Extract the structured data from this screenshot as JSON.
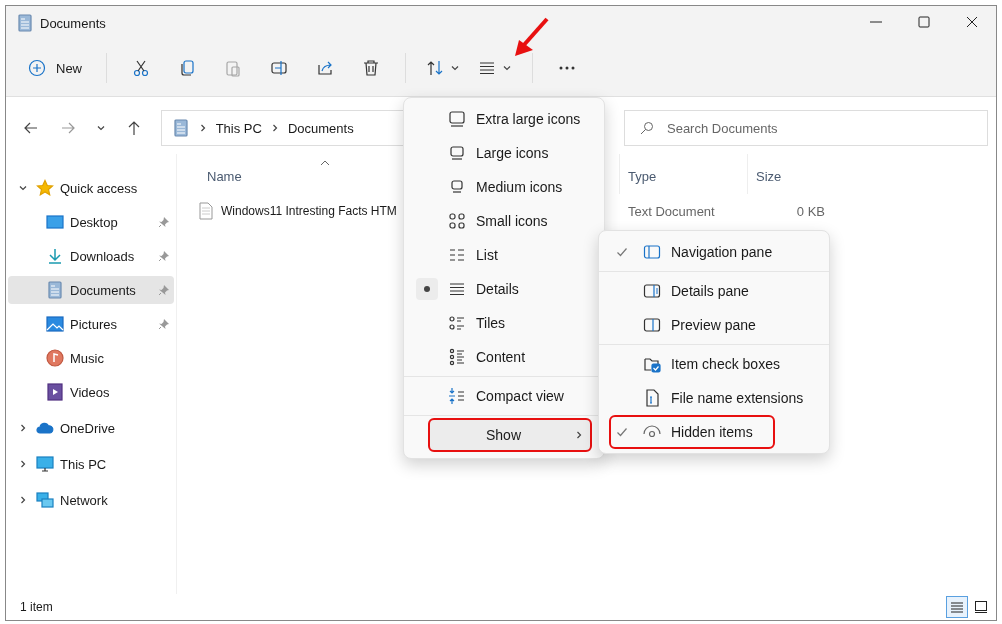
{
  "window": {
    "title": "Documents"
  },
  "toolbar": {
    "new_label": "New",
    "tools": [
      {
        "kind": "cut",
        "disabled": false
      },
      {
        "kind": "copy",
        "disabled": false
      },
      {
        "kind": "paste",
        "disabled": true
      },
      {
        "kind": "rename",
        "disabled": false
      },
      {
        "kind": "share",
        "disabled": false
      },
      {
        "kind": "delete",
        "disabled": false
      },
      {
        "kind": "sort",
        "disabled": false
      },
      {
        "kind": "view",
        "disabled": false
      },
      {
        "kind": "more",
        "disabled": false
      }
    ]
  },
  "address": {
    "segments": [
      "This PC",
      "Documents"
    ]
  },
  "search": {
    "placeholder": "Search Documents"
  },
  "sidebar": {
    "items": [
      {
        "label": "Quick access",
        "expanded": true,
        "selected": false,
        "children": [
          {
            "label": "Desktop",
            "pinned": true,
            "selected": false
          },
          {
            "label": "Downloads",
            "pinned": true,
            "selected": false
          },
          {
            "label": "Documents",
            "pinned": true,
            "selected": true
          },
          {
            "label": "Pictures",
            "pinned": true,
            "selected": false
          },
          {
            "label": "Music",
            "pinned": false,
            "selected": false
          },
          {
            "label": "Videos",
            "pinned": false,
            "selected": false
          }
        ]
      },
      {
        "label": "OneDrive",
        "expanded": false,
        "selected": false
      },
      {
        "label": "This PC",
        "expanded": false,
        "selected": false
      },
      {
        "label": "Network",
        "expanded": false,
        "selected": false
      }
    ]
  },
  "table": {
    "columns": [
      {
        "label": "Name",
        "sorted": true
      },
      {
        "label": "Type",
        "sorted": false
      },
      {
        "label": "Size",
        "sorted": false
      }
    ],
    "rows": [
      {
        "name": "Windows11 Intresting Facts HTM",
        "type": "Text Document",
        "size": "0 KB"
      }
    ]
  },
  "view_menu": {
    "items": [
      {
        "kind": "layout",
        "label": "Extra large icons",
        "selected": false
      },
      {
        "kind": "layout",
        "label": "Large icons",
        "selected": false
      },
      {
        "kind": "layout",
        "label": "Medium icons",
        "selected": false
      },
      {
        "kind": "layout",
        "label": "Small icons",
        "selected": false
      },
      {
        "kind": "layout",
        "label": "List",
        "selected": false
      },
      {
        "kind": "layout",
        "label": "Details",
        "selected": true
      },
      {
        "kind": "layout",
        "label": "Tiles",
        "selected": false
      },
      {
        "kind": "layout",
        "label": "Content",
        "selected": false
      },
      {
        "kind": "toggle",
        "label": "Compact view",
        "selected": false
      },
      {
        "kind": "submenu",
        "label": "Show",
        "expanded": true,
        "annotated": true
      }
    ]
  },
  "show_menu": {
    "groups": [
      [
        {
          "label": "Navigation pane",
          "checked": true,
          "annotated": false
        }
      ],
      [
        {
          "label": "Details pane",
          "checked": false,
          "annotated": false
        },
        {
          "label": "Preview pane",
          "checked": false,
          "annotated": false
        }
      ],
      [
        {
          "label": "Item check boxes",
          "checked": false,
          "annotated": false
        },
        {
          "label": "File name extensions",
          "checked": false,
          "annotated": false
        },
        {
          "label": "Hidden items",
          "checked": true,
          "annotated": true
        }
      ]
    ]
  },
  "status_bar": {
    "text": "1 item",
    "views": [
      {
        "kind": "details",
        "selected": true
      },
      {
        "kind": "tiles",
        "selected": false
      }
    ]
  }
}
